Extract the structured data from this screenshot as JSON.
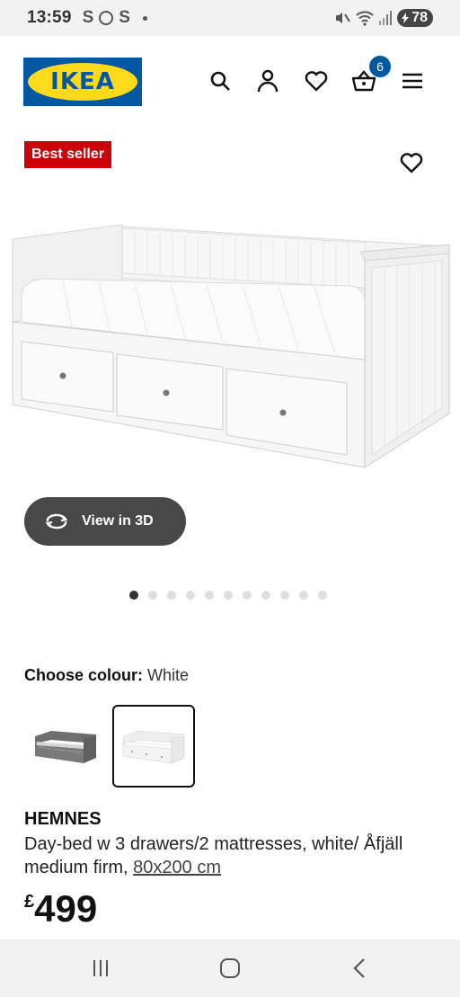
{
  "status_bar": {
    "time": "13:59",
    "left_icons": [
      "S",
      "S"
    ],
    "battery": "78"
  },
  "header": {
    "logo_text": "IKEA",
    "cart_count": "6",
    "icons": [
      "search-icon",
      "profile-icon",
      "wishlist-heart-icon",
      "cart-basket-icon",
      "menu-icon"
    ]
  },
  "product": {
    "badge": "Best seller",
    "view_3d_label": "View in 3D",
    "gallery_count": 11,
    "gallery_active": 1,
    "colour_label": "Choose colour:",
    "colour_value": "White",
    "colour_options": [
      "Grey",
      "White"
    ],
    "name": "HEMNES",
    "description": "Day-bed w 3 drawers/2 mattresses, white/ Åfjäll medium firm,",
    "size_link": "80x200 cm",
    "currency": "£",
    "price": "499"
  },
  "colors": {
    "brand_blue": "#0058a3",
    "brand_yellow": "#ffda1a",
    "badge_red": "#cc0008",
    "button_dark": "#484848"
  }
}
